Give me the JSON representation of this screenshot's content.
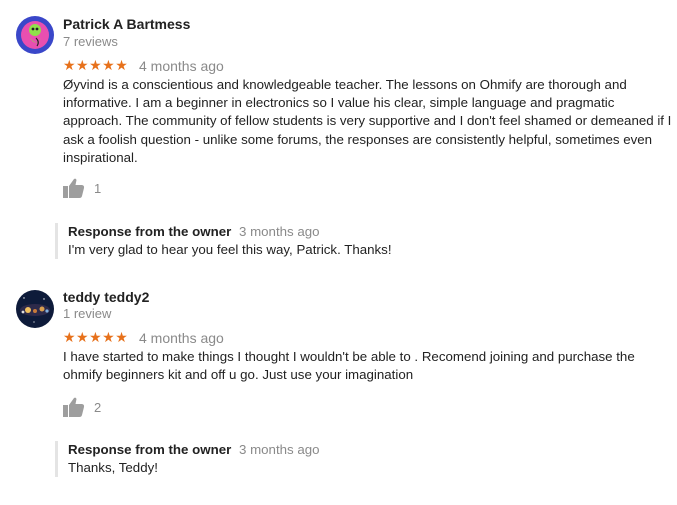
{
  "reviews": [
    {
      "name": "Patrick A Bartmess",
      "count": "7 reviews",
      "stars": "★★★★★",
      "date": "4 months ago",
      "text": "Øyvind is a conscientious and knowledgeable teacher. The lessons on Ohmify are thorough and informative. I am a beginner in electronics so I value his clear, simple language and pragmatic approach. The community of fellow students is very supportive and I don't feel shamed or demeaned if I ask a foolish question - unlike some forums, the responses are consistently helpful, sometimes even inspirational.",
      "likes": "1",
      "response": {
        "label": "Response from the owner",
        "date": "3 months ago",
        "text": "I'm very glad to hear you feel this way, Patrick. Thanks!"
      }
    },
    {
      "name": "teddy teddy2",
      "count": "1 review",
      "stars": "★★★★★",
      "date": "4 months ago",
      "text": "I have started to make things I thought I wouldn't be able to . Recomend joining and purchase the ohmify beginners kit and off u go. Just use your imagination",
      "likes": "2",
      "response": {
        "label": "Response from the owner",
        "date": "3 months ago",
        "text": "Thanks, Teddy!"
      }
    }
  ],
  "colors": {
    "star": "#e7711b",
    "muted": "#8a8a8a",
    "thumb": "#9e9e9e",
    "response_border": "#e4e4e4"
  },
  "icons": [
    "thumbs-up-icon",
    "avatar-patrick",
    "avatar-teddy"
  ]
}
